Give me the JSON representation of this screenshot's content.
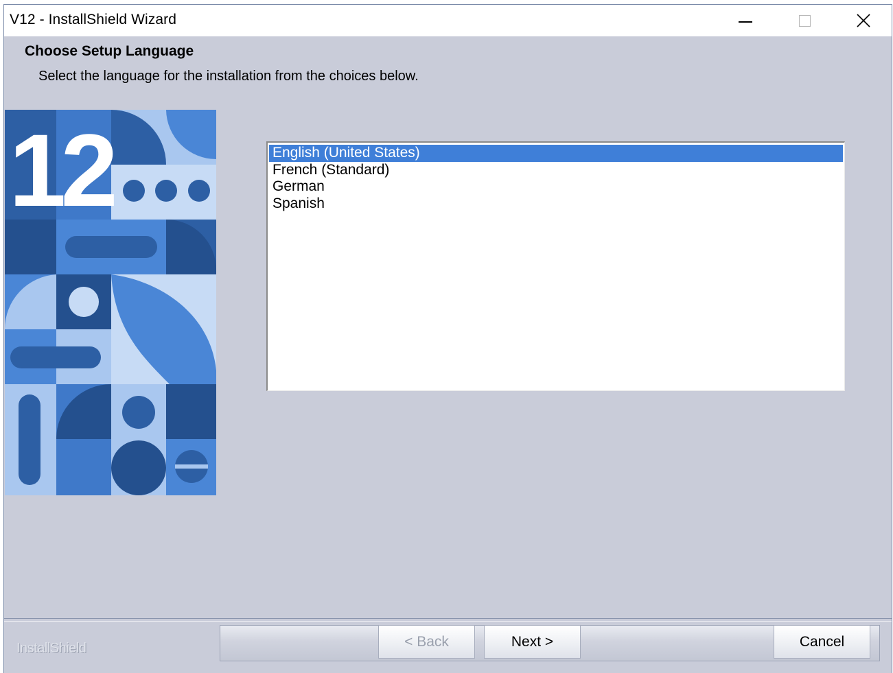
{
  "window": {
    "title": "V12 - InstallShield Wizard",
    "controls": [
      "minimize-icon",
      "maximize-icon",
      "close-icon"
    ]
  },
  "header": {
    "title": "Choose Setup Language",
    "subtitle": "Select the language for the installation from the choices below."
  },
  "banner": {
    "number": "12"
  },
  "languages": {
    "items": [
      {
        "label": "English (United States)",
        "selected": true
      },
      {
        "label": "French (Standard)",
        "selected": false
      },
      {
        "label": "German",
        "selected": false
      },
      {
        "label": "Spanish",
        "selected": false
      }
    ]
  },
  "footer": {
    "brand": "InstallShield",
    "back_label": "< Back",
    "next_label": "Next >",
    "cancel_label": "Cancel"
  },
  "colors": {
    "selection": "#3f7fd8",
    "dialog_background": "#c9ccd9",
    "banner_dark": "#2d5fa4",
    "banner_light": "#a9c7ef"
  }
}
